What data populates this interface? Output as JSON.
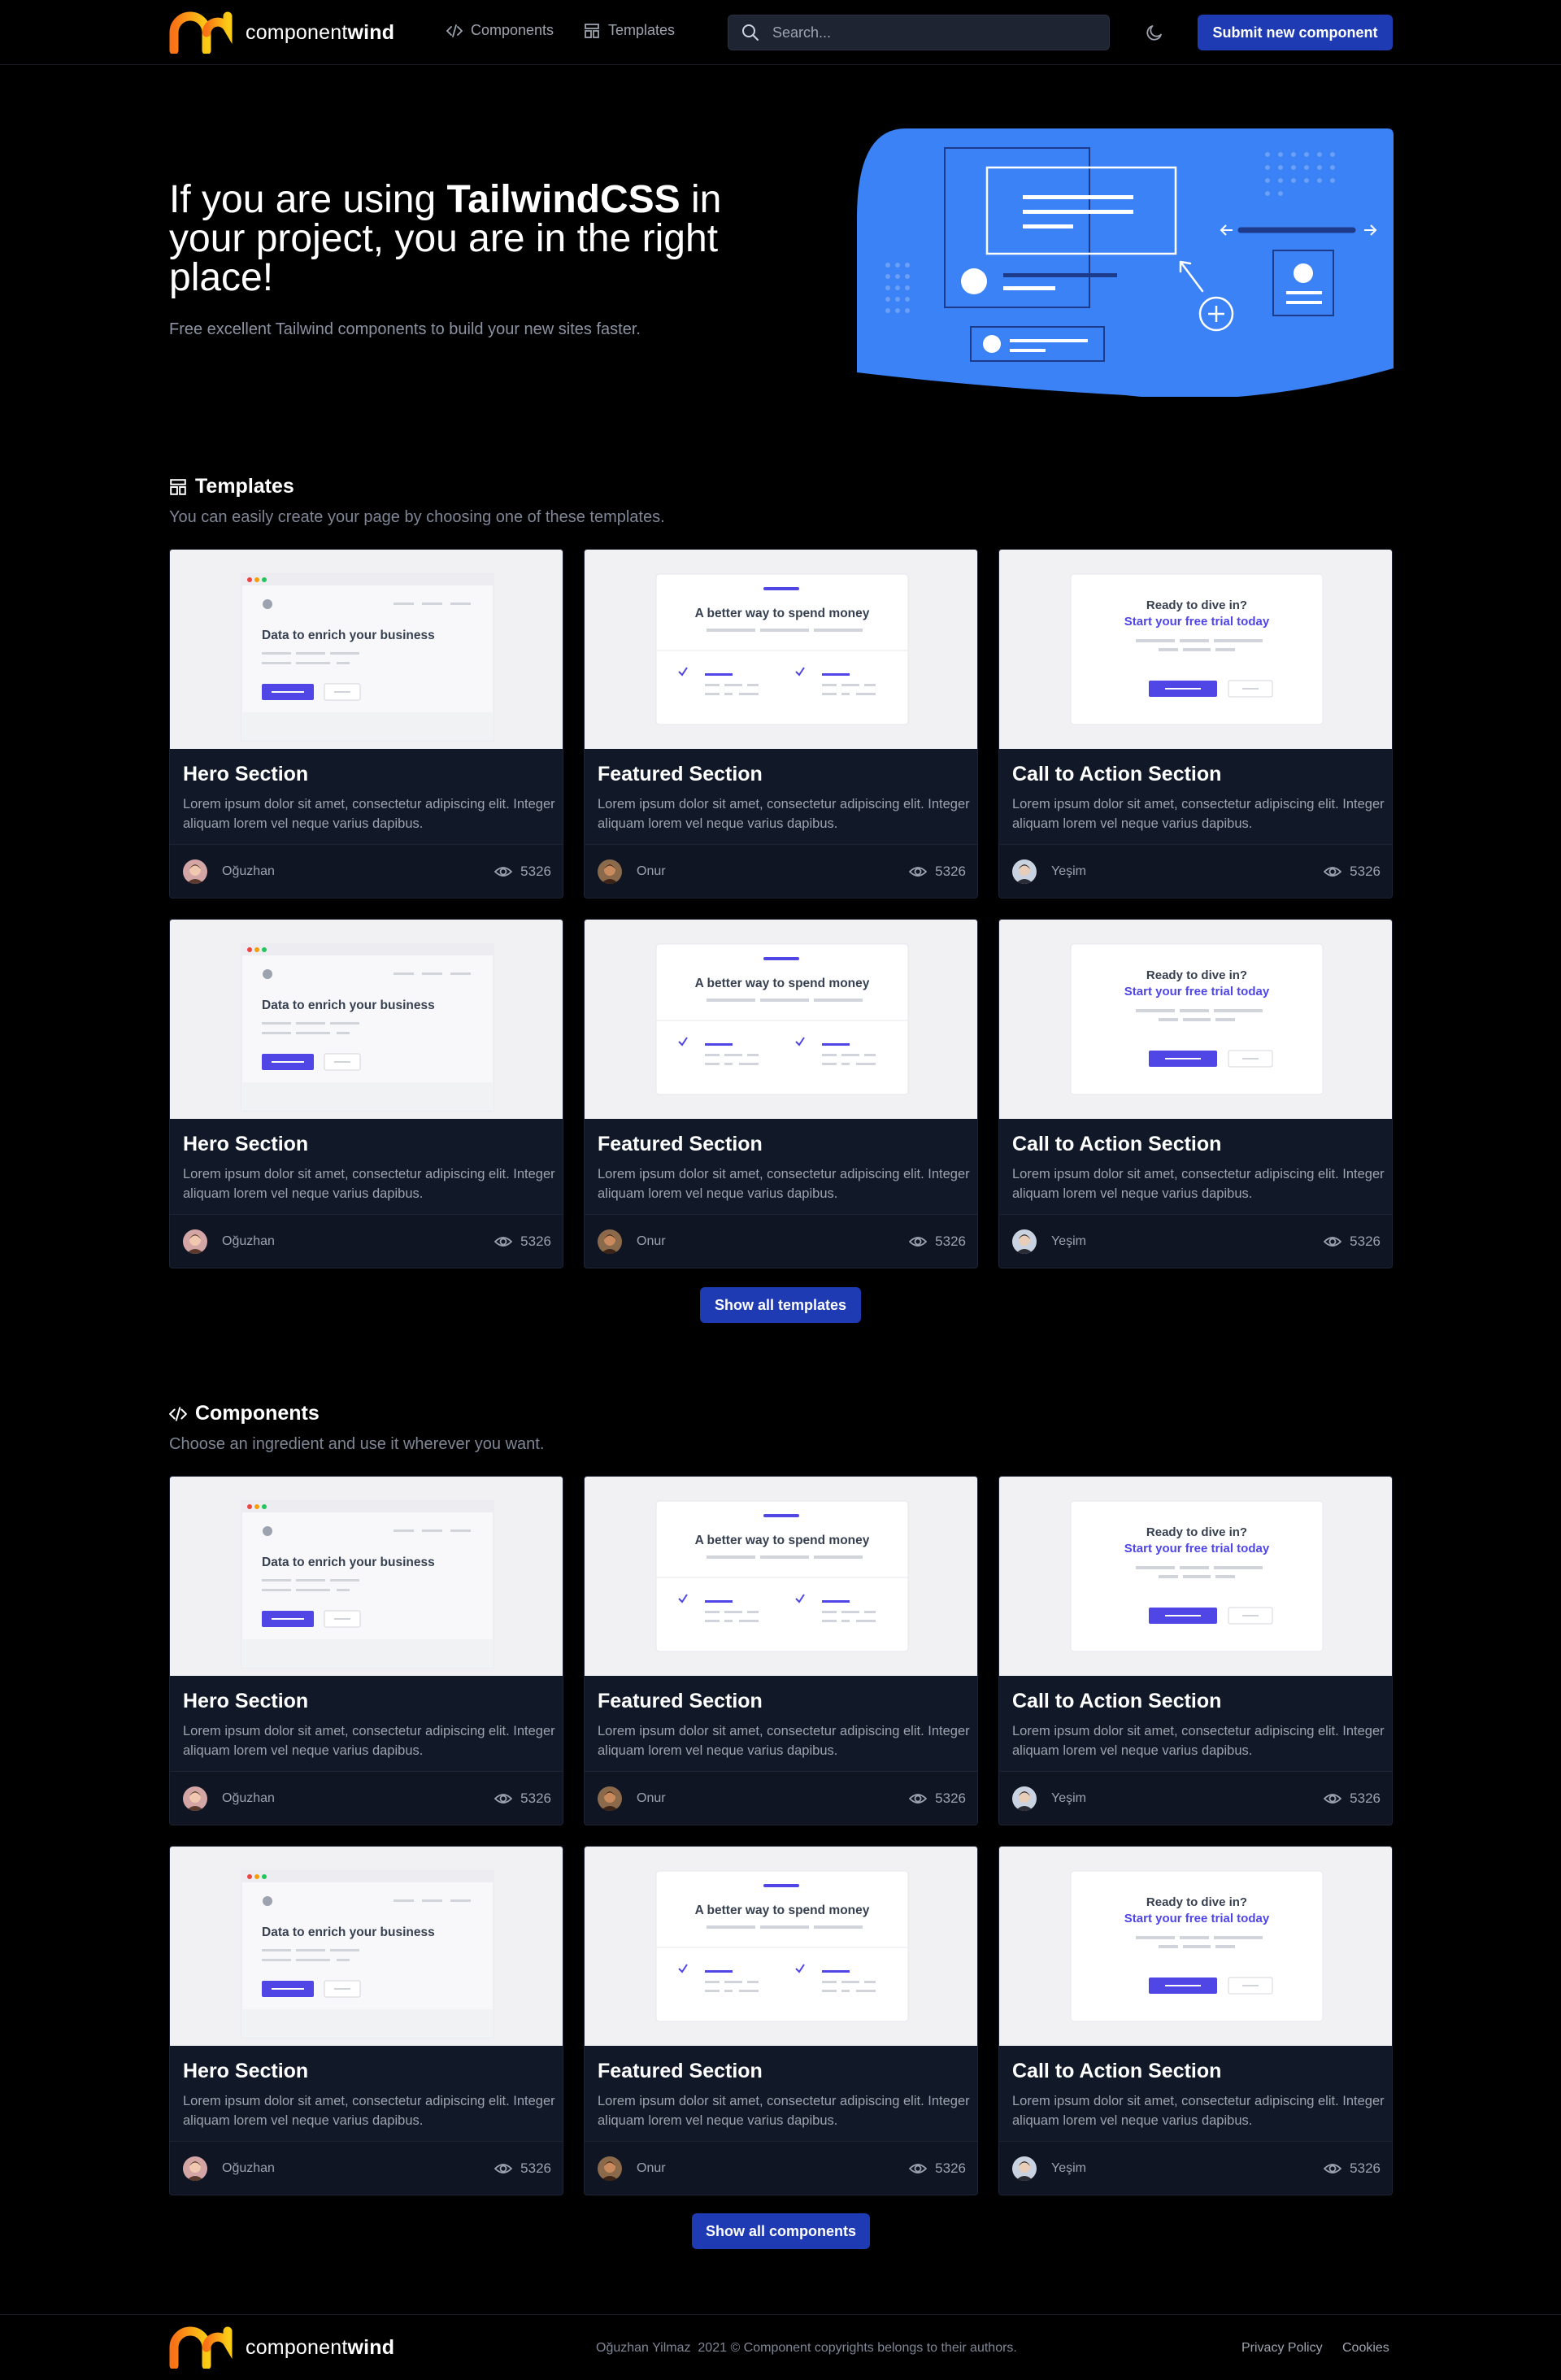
{
  "nav": {
    "brand_light": "component",
    "brand_bold": "wind",
    "components_label": "Components",
    "templates_label": "Templates",
    "search_placeholder": "Search...",
    "submit_label": "Submit new component"
  },
  "hero": {
    "title_pre": "If you are using ",
    "title_bold": "TailwindCSS",
    "title_post": " in your project, you are in the right place!",
    "subtitle": "Free excellent Tailwind components to build your new sites faster."
  },
  "templates": {
    "heading": "Templates",
    "subheading": "You can easily create your page by choosing one of these templates.",
    "show_all": "Show all templates"
  },
  "components": {
    "heading": "Components",
    "subheading": "Choose an ingredient and use it wherever you want.",
    "show_all": "Show all components"
  },
  "thumb_text": {
    "hero": "Data to enrich your business",
    "feature": "A better way to spend money",
    "cta_line1": "Ready to dive in?",
    "cta_line2": "Start your free trial today"
  },
  "cards": [
    {
      "title": "Hero Section",
      "desc": "Lorem ipsum dolor sit amet, consectetur adipiscing elit. Integer aliquam lorem vel neque varius dapibus.",
      "author": "Oğuzhan",
      "views": "5326"
    },
    {
      "title": "Featured Section",
      "desc": "Lorem ipsum dolor sit amet, consectetur adipiscing elit. Integer aliquam lorem vel neque varius dapibus.",
      "author": "Onur",
      "views": "5326"
    },
    {
      "title": "Call to Action Section",
      "desc": "Lorem ipsum dolor sit amet, consectetur adipiscing elit. Integer aliquam lorem vel neque varius dapibus.",
      "author": "Yeşim",
      "views": "5326"
    }
  ],
  "footer": {
    "brand_light": "component",
    "brand_bold": "wind",
    "copyright": "Oğuzhan Yilmaz  2021 © Component copyrights belongs to their authors.",
    "privacy": "Privacy Policy",
    "cookies": "Cookies"
  },
  "colors": {
    "accent": "#1e3bb3",
    "hero_art": "#3b82f6",
    "logo_start": "#f97316",
    "logo_end": "#facc15",
    "thumb_accent": "#4f46e5"
  },
  "icons": [
    "code-icon",
    "template-icon",
    "search-icon",
    "moon-icon",
    "eye-icon",
    "plus-icon",
    "arrow-icon"
  ]
}
